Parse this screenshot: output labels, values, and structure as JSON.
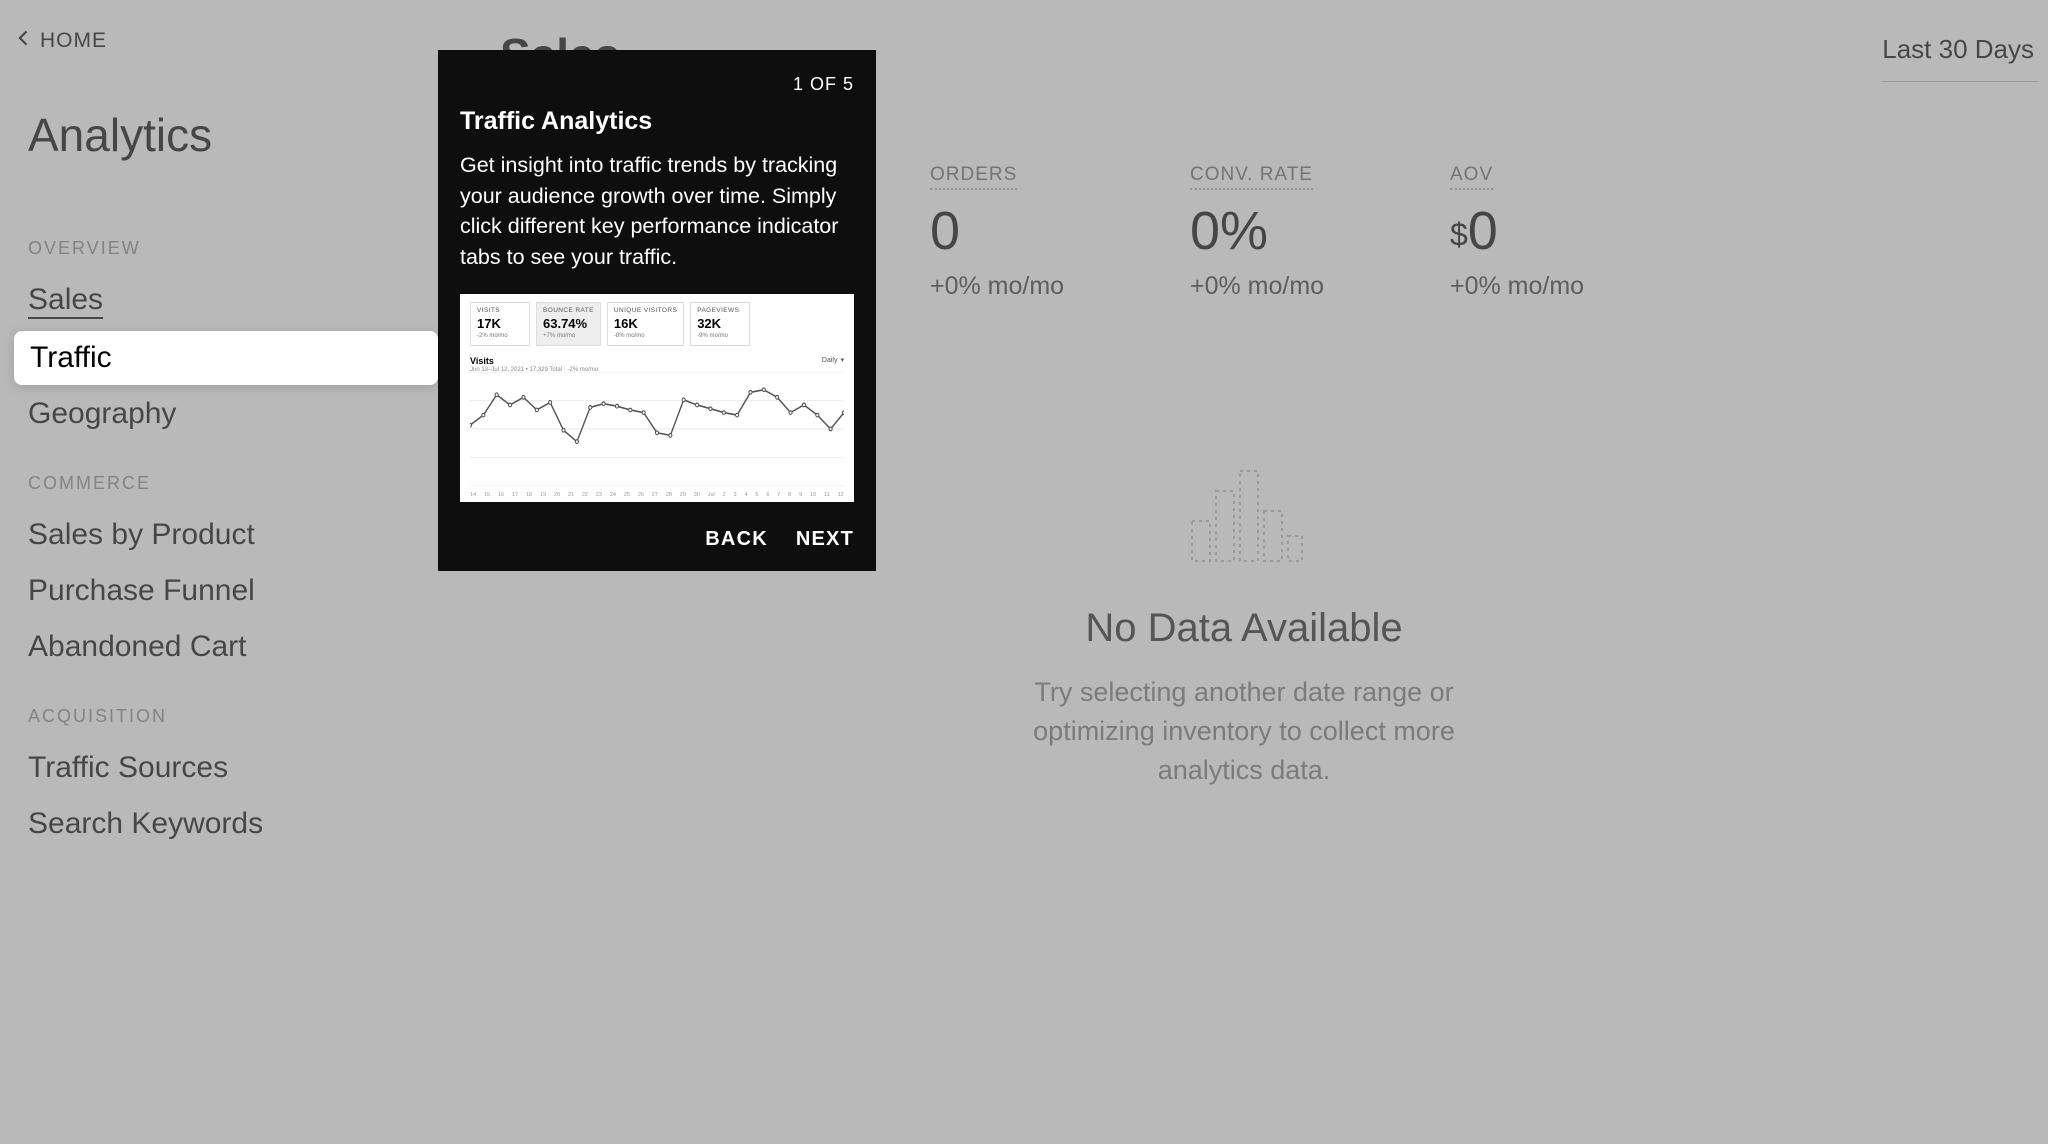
{
  "home_label": "HOME",
  "page_title": "Analytics",
  "sidebar": {
    "sections": [
      {
        "header": "OVERVIEW",
        "items": [
          "Sales",
          "Traffic",
          "Geography"
        ]
      },
      {
        "header": "COMMERCE",
        "items": [
          "Sales by Product",
          "Purchase Funnel",
          "Abandoned Cart"
        ]
      },
      {
        "header": "ACQUISITION",
        "items": [
          "Traffic Sources",
          "Search Keywords"
        ]
      }
    ],
    "selected": "Sales",
    "highlighted": "Traffic"
  },
  "main": {
    "title": "Sales",
    "date_range": "Last 30 Days",
    "kpis": [
      {
        "label": "ORDERS",
        "value": "0",
        "delta": "+0% mo/mo"
      },
      {
        "label": "CONV. RATE",
        "value": "0%",
        "delta": "+0% mo/mo"
      },
      {
        "label": "AOV",
        "prefix": "$",
        "value": "0",
        "delta": "+0% mo/mo"
      }
    ],
    "empty_state": {
      "title": "No Data Available",
      "desc": "Try selecting another date range or optimizing inventory to collect more analytics data."
    }
  },
  "modal": {
    "step": "1 OF 5",
    "title": "Traffic Analytics",
    "body": "Get insight into traffic trends by tracking your audience growth over time. Simply click different key performance indicator tabs to see your traffic.",
    "back": "BACK",
    "next": "NEXT",
    "chart": {
      "tabs": [
        {
          "label": "VISITS",
          "value": "17K",
          "sub": "-2% mo/mo"
        },
        {
          "label": "BOUNCE RATE",
          "value": "63.74%",
          "sub": "+7% mo/mo"
        },
        {
          "label": "UNIQUE VISITORS",
          "value": "16K",
          "sub": "-8% mo/mo"
        },
        {
          "label": "PAGEVIEWS",
          "value": "32K",
          "sub": "-9% mo/mo"
        }
      ],
      "active_tab": 1,
      "subtitle_label": "Visits",
      "subtitle_detail": "Jun 13–Jul 12, 2021 • 17,329 Total · -2% mo/mo",
      "dropdown": "Daily",
      "x_ticks": [
        "14",
        "15",
        "16",
        "17",
        "18",
        "19",
        "20",
        "21",
        "22",
        "23",
        "24",
        "25",
        "26",
        "27",
        "28",
        "29",
        "30",
        "Jul",
        "2",
        "3",
        "4",
        "5",
        "6",
        "7",
        "8",
        "9",
        "10",
        "11",
        "12"
      ]
    }
  },
  "chart_data": {
    "type": "line",
    "title": "Visits",
    "xlabel": "",
    "ylabel": "",
    "ylim": [
      0,
      900
    ],
    "x": [
      "Jun 14",
      "Jun 15",
      "Jun 16",
      "Jun 17",
      "Jun 18",
      "Jun 19",
      "Jun 20",
      "Jun 21",
      "Jun 22",
      "Jun 23",
      "Jun 24",
      "Jun 25",
      "Jun 26",
      "Jun 27",
      "Jun 28",
      "Jun 29",
      "Jun 30",
      "Jul 1",
      "Jul 2",
      "Jul 3",
      "Jul 4",
      "Jul 5",
      "Jul 6",
      "Jul 7",
      "Jul 8",
      "Jul 9",
      "Jul 10",
      "Jul 11",
      "Jul 12"
    ],
    "series": [
      {
        "name": "Visits",
        "values": [
          480,
          560,
          720,
          640,
          700,
          600,
          660,
          440,
          350,
          620,
          650,
          630,
          600,
          580,
          420,
          400,
          680,
          640,
          610,
          580,
          560,
          740,
          760,
          700,
          580,
          640,
          560,
          450,
          580
        ]
      }
    ]
  }
}
